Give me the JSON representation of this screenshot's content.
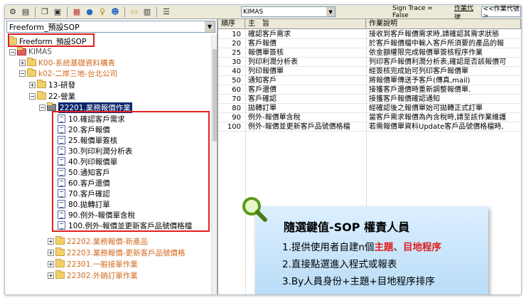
{
  "toolbar": {
    "icons": [
      "settings-icon",
      "print-icon",
      "copy-icon",
      "paste-icon",
      "grid-icon",
      "globe-icon",
      "key-icon",
      "user-icon",
      "folder-icon",
      "table-icon",
      "list-icon"
    ],
    "kimas_combo": "KIMAS",
    "sign_trace": "Sign Trace = False",
    "job_code_label": "作業代號",
    "job_code_value": "<<作業代號>"
  },
  "left": {
    "combo_value": "Freeform_預設SOP",
    "tree": {
      "root": "Freeform_預設SOP",
      "kimas": "KIMAS",
      "k00": "K00-系統基礎資料構青",
      "k02": "k02-二岸三地-台北公司",
      "n13": "13-研發",
      "n22": "22-營業",
      "n22201": "22201.業務報價作業",
      "children": [
        "10.確認客戶需求",
        "20.客戶報價",
        "25.報價單簽核",
        "30.列印利潤分析表",
        "40.列印報價單",
        "50.通知客戶",
        "60.客戶還價",
        "70.客戶確認",
        "80.拋轉訂單",
        "90.例外-報價單含稅",
        "100.例外-報價並更新客戶品號價格檔"
      ],
      "n22202": "22202.業務報價-新產品",
      "n22203": "22203.業務報價-更新客戶品號價格",
      "n22301": "22301.一般接單作業",
      "n22302": "22302.外銷訂單作業"
    }
  },
  "grid": {
    "headers": [
      "順序",
      "主　旨",
      "作業說明"
    ],
    "rows": [
      {
        "seq": "10",
        "subject": "確認客戶需求",
        "desc": "接收到客戶報價需求時,請確認其需求狀態"
      },
      {
        "seq": "20",
        "subject": "客戶報價",
        "desc": "於客戶報價檔中輸入客戶所須要的產品的報"
      },
      {
        "seq": "25",
        "subject": "報價單簽核",
        "desc": "依金額權限完成報價單簽核程序作業"
      },
      {
        "seq": "30",
        "subject": "列印利潤分析表",
        "desc": "列印客戶報價利潤分析表,確認是否該報價可"
      },
      {
        "seq": "40",
        "subject": "列印報價單",
        "desc": "經簽核完成始可列印客戶報價單"
      },
      {
        "seq": "50",
        "subject": "通知客戶",
        "desc": "將報價單傳送予客戶(傳真,mail)"
      },
      {
        "seq": "60",
        "subject": "客戶還價",
        "desc": "接獲客戶還價時重新調整報價單."
      },
      {
        "seq": "70",
        "subject": "客戶確認",
        "desc": "接獲客戶報價確認通知"
      },
      {
        "seq": "80",
        "subject": "拋轉訂單",
        "desc": "經確認後之報價單始可拋轉正式訂單"
      },
      {
        "seq": "90",
        "subject": "例外-報價單含稅",
        "desc": "當客戶需求報價為內含稅時,請至該作業維護"
      },
      {
        "seq": "100",
        "subject": "例外-報價並更新客戶品號價格檔",
        "desc": "若需報價單資料Update客戶品號價格檔時,"
      }
    ]
  },
  "callout": {
    "title": "隨選鍵值-SOP 權責人員",
    "line1_prefix": "1.提供使用者自建n個",
    "line1_red1": "主題",
    "line1_mid": "、",
    "line1_red2": "目地程序",
    "line2": "2.直接點選進入程式或報表",
    "line3": "3.By人員身份+主題+目地程序排序"
  },
  "colors": {
    "highlight_box": "#e02020",
    "selected_bg": "#0a246a",
    "orange_text": "#d2691e",
    "callout_bg": "#c9e5fa"
  }
}
